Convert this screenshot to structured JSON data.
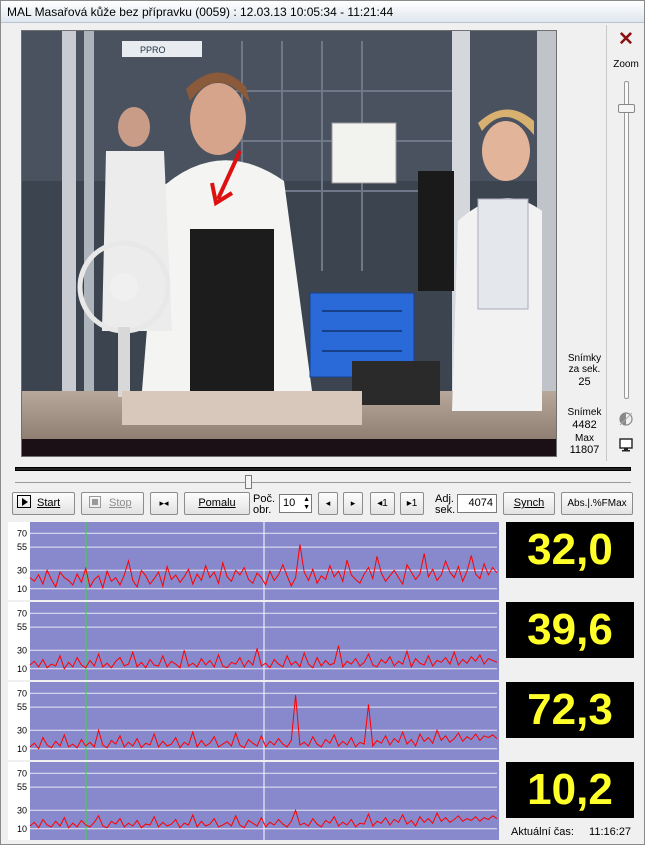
{
  "window": {
    "title": "MAL Masařová kůže bez přípravku    (0059) : 12.03.13  10:05:34 - 11:21:44"
  },
  "video": {
    "banner_text": "PPRO"
  },
  "side_panel": {
    "fps_label_1": "Snímky",
    "fps_label_2": "za sek.",
    "fps_value": "25",
    "frame_label": "Snímek",
    "frame_value": "4482",
    "max_label": "Max",
    "max_value": "11807"
  },
  "zoom_panel": {
    "close_glyph": "✕",
    "zoom_label": "Zoom",
    "icons": [
      "contrast-icon",
      "monitor-icon"
    ]
  },
  "toolbar": {
    "start_label": "Start",
    "stop_label": "Stop",
    "prev_frame_glyph": "▸◂",
    "slow_label": "Pomalu",
    "count_label_1": "Poč.",
    "count_label_2": "obr.",
    "count_value": "10",
    "step_back_glyph": "◂",
    "step_fwd_glyph": "▸",
    "back_one_glyph": "◂1",
    "fwd_one_glyph": "▸1",
    "adj_label_1": "Adj.",
    "adj_label_2": "sek.",
    "adj_value": "4074",
    "synch_label": "Synch",
    "abs_label": "Abs.|.%FMax"
  },
  "charts": {
    "y_ticks": [
      "70",
      "55",
      "30",
      "10"
    ],
    "readouts": [
      "32,0",
      "39,6",
      "72,3",
      "10,2"
    ]
  },
  "footer": {
    "clock_label": "Aktuální čas:",
    "clock_value": "11:16:27"
  },
  "colors": {
    "chart_bg": "#8888cc",
    "signal": "#ff0000",
    "readout_bg": "#000000",
    "readout_fg": "#ffff2a",
    "cursor_green": "#33dd33"
  },
  "chart_data": [
    {
      "type": "line",
      "ylim": [
        0,
        80
      ],
      "y_ticks": [
        70,
        55,
        30,
        10
      ],
      "series": [
        {
          "values": [
            22,
            18,
            25,
            15,
            30,
            20,
            12,
            28,
            22,
            19,
            14,
            26,
            17,
            32,
            12,
            20,
            24,
            11,
            29,
            18,
            22,
            14,
            25,
            40,
            19,
            12,
            30,
            24,
            15,
            21,
            28,
            13,
            34,
            20,
            25,
            17,
            23,
            31,
            15,
            26,
            19,
            35,
            22,
            28,
            16,
            38,
            23,
            18,
            30,
            25,
            33,
            20,
            16,
            27,
            22,
            14,
            29,
            19,
            25,
            36,
            24,
            13,
            22,
            58,
            28,
            19,
            31,
            16,
            24,
            20,
            35,
            23,
            29,
            18,
            41,
            25,
            20,
            16,
            26,
            33,
            21,
            45,
            27,
            18,
            24,
            30,
            22,
            15,
            36,
            28,
            20,
            26,
            48,
            23,
            31,
            19,
            25,
            40,
            28,
            22,
            34,
            18,
            29,
            46,
            26,
            21,
            37,
            25,
            33,
            27
          ]
        }
      ]
    },
    {
      "type": "line",
      "ylim": [
        0,
        80
      ],
      "y_ticks": [
        70,
        55,
        30,
        10
      ],
      "series": [
        {
          "values": [
            14,
            18,
            12,
            20,
            11,
            15,
            13,
            24,
            10,
            17,
            12,
            22,
            14,
            11,
            19,
            13,
            26,
            12,
            16,
            11,
            18,
            22,
            13,
            15,
            28,
            12,
            17,
            11,
            20,
            14,
            13,
            24,
            12,
            18,
            15,
            11,
            30,
            13,
            16,
            12,
            21,
            14,
            19,
            12,
            25,
            13,
            11,
            17,
            15,
            22,
            12,
            19,
            14,
            32,
            13,
            16,
            11,
            20,
            15,
            12,
            24,
            14,
            18,
            12,
            27,
            15,
            11,
            22,
            13,
            19,
            14,
            16,
            35,
            12,
            18,
            15,
            21,
            13,
            17,
            26,
            14,
            12,
            20,
            16,
            23,
            13,
            18,
            15,
            29,
            12,
            21,
            16,
            14,
            24,
            13,
            19,
            17,
            22,
            15,
            28,
            14,
            20,
            16,
            23,
            18,
            25,
            15,
            21,
            19,
            17
          ]
        }
      ]
    },
    {
      "type": "line",
      "ylim": [
        0,
        80
      ],
      "y_ticks": [
        70,
        55,
        30,
        10
      ],
      "series": [
        {
          "values": [
            12,
            16,
            10,
            22,
            14,
            11,
            18,
            13,
            25,
            12,
            15,
            11,
            20,
            13,
            17,
            12,
            30,
            14,
            11,
            19,
            15,
            24,
            12,
            17,
            13,
            21,
            11,
            16,
            14,
            26,
            12,
            18,
            13,
            15,
            22,
            11,
            17,
            14,
            28,
            12,
            19,
            13,
            16,
            23,
            12,
            15,
            18,
            13,
            27,
            14,
            11,
            20,
            16,
            13,
            24,
            12,
            18,
            14,
            21,
            15,
            12,
            19,
            68,
            14,
            17,
            13,
            23,
            15,
            12,
            20,
            16,
            25,
            13,
            18,
            14,
            22,
            12,
            17,
            15,
            58,
            13,
            19,
            16,
            24,
            14,
            21,
            17,
            28,
            15,
            20,
            13,
            26,
            18,
            22,
            16,
            30,
            19,
            24,
            17,
            21,
            27,
            18,
            23,
            20,
            26,
            19,
            24,
            22,
            25,
            21
          ]
        }
      ]
    },
    {
      "type": "line",
      "ylim": [
        0,
        80
      ],
      "y_ticks": [
        70,
        55,
        30,
        10
      ],
      "series": [
        {
          "values": [
            13,
            17,
            11,
            20,
            14,
            12,
            18,
            13,
            22,
            11,
            16,
            12,
            19,
            14,
            12,
            17,
            24,
            13,
            11,
            18,
            15,
            21,
            12,
            16,
            13,
            19,
            11,
            15,
            14,
            23,
            12,
            17,
            13,
            15,
            20,
            11,
            16,
            14,
            25,
            12,
            18,
            13,
            15,
            21,
            12,
            14,
            17,
            13,
            24,
            14,
            11,
            19,
            16,
            13,
            22,
            12,
            17,
            14,
            20,
            15,
            12,
            18,
            30,
            14,
            16,
            13,
            21,
            15,
            12,
            19,
            16,
            23,
            13,
            17,
            14,
            20,
            12,
            16,
            15,
            26,
            13,
            18,
            16,
            22,
            14,
            20,
            17,
            25,
            15,
            19,
            13,
            23,
            17,
            21,
            16,
            27,
            18,
            22,
            17,
            20,
            24,
            18,
            21,
            19,
            23,
            18,
            22,
            20,
            24,
            21
          ]
        }
      ]
    }
  ]
}
